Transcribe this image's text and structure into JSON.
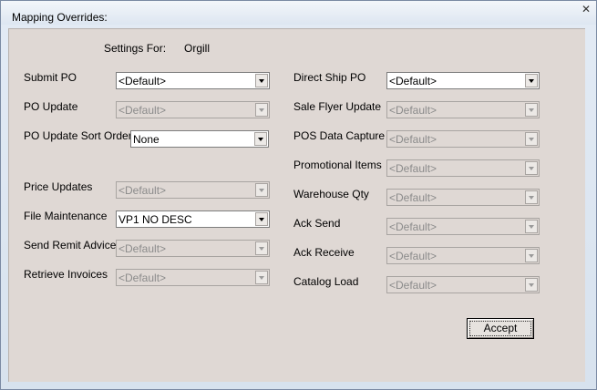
{
  "window": {
    "title": "Mapping Overrides:",
    "close_glyph": "✕"
  },
  "settings": {
    "label": "Settings For:",
    "value": "Orgill"
  },
  "left_fields": [
    {
      "label": "Submit PO",
      "value": "<Default>",
      "enabled": true
    },
    {
      "label": "PO Update",
      "value": "<Default>",
      "enabled": false
    },
    {
      "label": "PO Update Sort Order:",
      "value": "None",
      "enabled": true
    },
    {
      "label": "Price Updates",
      "value": "<Default>",
      "enabled": false
    },
    {
      "label": "File Maintenance",
      "value": "VP1 NO DESC",
      "enabled": true
    },
    {
      "label": "Send Remit Advice",
      "value": "<Default>",
      "enabled": false
    },
    {
      "label": "Retrieve Invoices",
      "value": "<Default>",
      "enabled": false
    }
  ],
  "right_fields": [
    {
      "label": "Direct Ship PO",
      "value": "<Default>",
      "enabled": true
    },
    {
      "label": "Sale Flyer Update",
      "value": "<Default>",
      "enabled": false
    },
    {
      "label": "POS Data Capture",
      "value": "<Default>",
      "enabled": false
    },
    {
      "label": "Promotional Items",
      "value": "<Default>",
      "enabled": false
    },
    {
      "label": "Warehouse Qty",
      "value": "<Default>",
      "enabled": false
    },
    {
      "label": "Ack Send",
      "value": "<Default>",
      "enabled": false
    },
    {
      "label": "Ack Receive",
      "value": "<Default>",
      "enabled": false
    },
    {
      "label": "Catalog Load",
      "value": "<Default>",
      "enabled": false
    }
  ],
  "buttons": {
    "accept_label": "Accept"
  }
}
